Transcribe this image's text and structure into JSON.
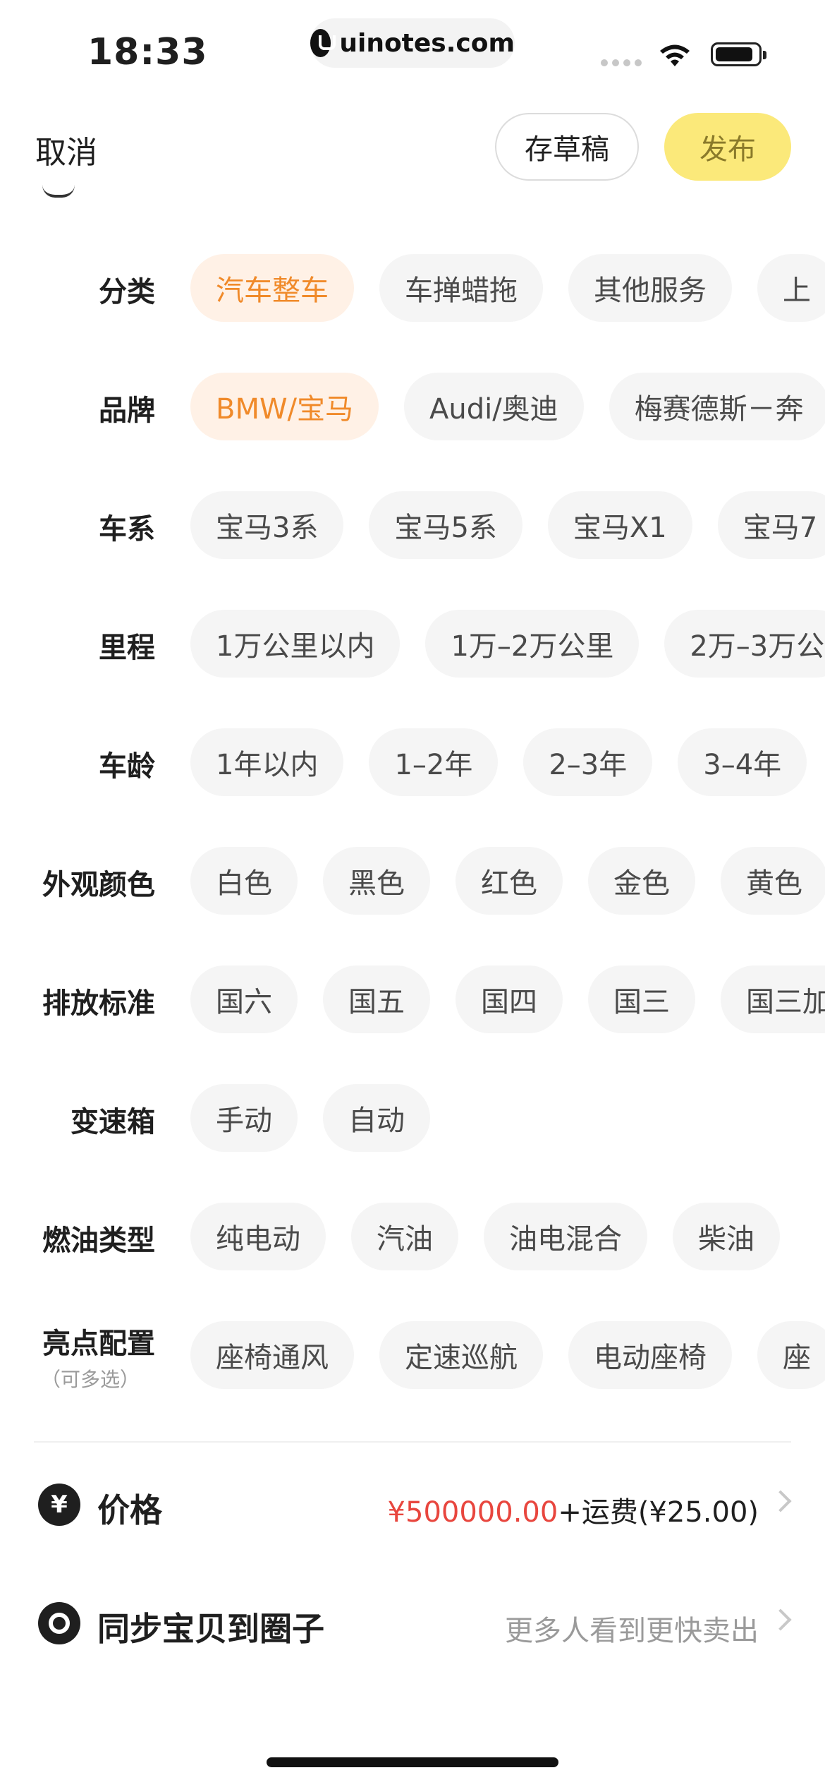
{
  "status": {
    "time": "18:33",
    "url": "uinotes.com"
  },
  "nav": {
    "cancel": "取消",
    "draft": "存草稿",
    "publish": "发布"
  },
  "rows": [
    {
      "label": "分类",
      "chips": [
        "汽车整车",
        "车掸蜡拖",
        "其他服务",
        "上"
      ],
      "selected": 0
    },
    {
      "label": "品牌",
      "chips": [
        "BMW/宝马",
        "Audi/奥迪",
        "梅赛德斯－奔"
      ],
      "selected": 0
    },
    {
      "label": "车系",
      "chips": [
        "宝马3系",
        "宝马5系",
        "宝马X1",
        "宝马7"
      ],
      "selected": -1
    },
    {
      "label": "里程",
      "chips": [
        "1万公里以内",
        "1万–2万公里",
        "2万–3万公"
      ],
      "selected": -1
    },
    {
      "label": "车龄",
      "chips": [
        "1年以内",
        "1–2年",
        "2–3年",
        "3–4年"
      ],
      "selected": -1
    },
    {
      "label": "外观颜色",
      "chips": [
        "白色",
        "黑色",
        "红色",
        "金色",
        "黄色"
      ],
      "selected": -1
    },
    {
      "label": "排放标准",
      "chips": [
        "国六",
        "国五",
        "国四",
        "国三",
        "国三加"
      ],
      "selected": -1
    },
    {
      "label": "变速箱",
      "chips": [
        "手动",
        "自动"
      ],
      "selected": -1
    },
    {
      "label": "燃油类型",
      "chips": [
        "纯电动",
        "汽油",
        "油电混合",
        "柴油"
      ],
      "selected": -1
    },
    {
      "label": "亮点配置",
      "sublabel": "（可多选）",
      "chips": [
        "座椅通风",
        "定速巡航",
        "电动座椅",
        "座"
      ],
      "selected": -1
    }
  ],
  "price": {
    "icon": "¥",
    "title": "价格",
    "amount": "¥500000.00",
    "shipping": "+运费(¥25.00)"
  },
  "sync": {
    "title": "同步宝贝到圈子",
    "hint": "更多人看到更快卖出"
  },
  "colors": {
    "accent_yellow": "#fbe97a",
    "selected_text": "#f08a2a",
    "selected_bg": "#fff1e6",
    "price_red": "#e8463e"
  }
}
